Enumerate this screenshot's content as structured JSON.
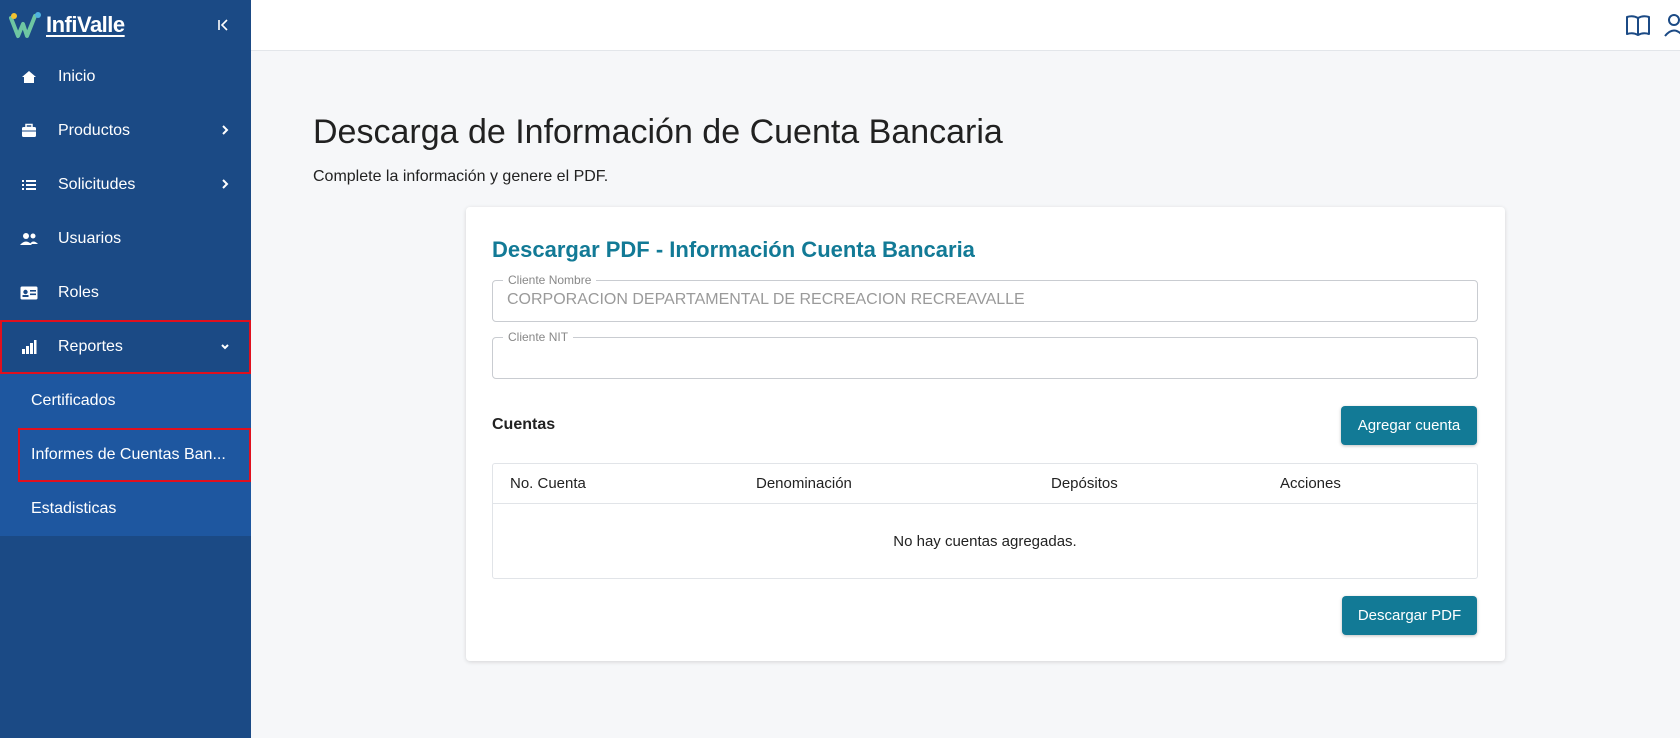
{
  "app": {
    "brand": "InfiValle",
    "accent_color": "#127a96",
    "sidebar_color": "#1b4a85"
  },
  "sidebar": {
    "items": [
      {
        "label": "Inicio",
        "icon": "home-icon"
      },
      {
        "label": "Productos",
        "icon": "briefcase-icon"
      },
      {
        "label": "Solicitudes",
        "icon": "list-icon"
      },
      {
        "label": "Usuarios",
        "icon": "users-icon"
      },
      {
        "label": "Roles",
        "icon": "id-card-icon"
      },
      {
        "label": "Reportes",
        "icon": "chart-icon"
      }
    ],
    "sub_items": [
      {
        "label": "Certificados"
      },
      {
        "label": "Informes de Cuentas Ban..."
      },
      {
        "label": "Estadisticas"
      }
    ]
  },
  "page": {
    "title": "Descarga de Información de Cuenta Bancaria",
    "subtitle": "Complete la información y genere el PDF."
  },
  "card": {
    "title": "Descargar PDF - Información Cuenta Bancaria",
    "client_name_label": "Cliente Nombre",
    "client_name_value": "CORPORACION DEPARTAMENTAL DE RECREACION RECREAVALLE",
    "client_nit_label": "Cliente NIT",
    "client_nit_value": "",
    "accounts_label": "Cuentas",
    "add_button": "Agregar cuenta",
    "download_button": "Descargar PDF",
    "table": {
      "headers": [
        "No. Cuenta",
        "Denominación",
        "Depósitos",
        "Acciones"
      ],
      "empty_text": "No hay cuentas agregadas."
    }
  }
}
